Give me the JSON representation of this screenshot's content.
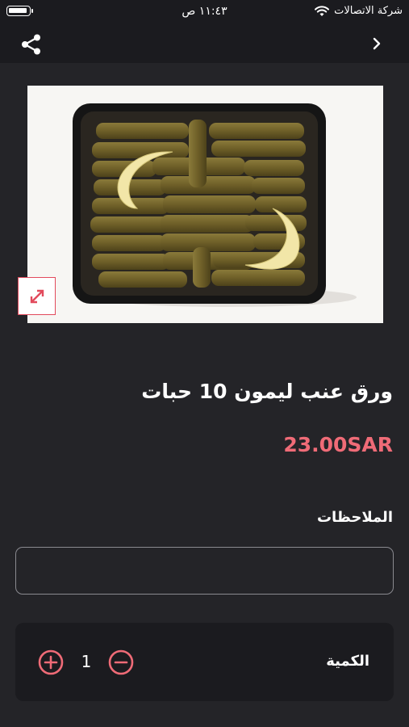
{
  "status_bar": {
    "carrier": "شركة الاتصالات",
    "time": "١١:٤٣ ص"
  },
  "nav": {
    "back_icon": "chevron-right-icon",
    "share_icon": "share-icon"
  },
  "product": {
    "image_alt": "",
    "expand_icon": "expand-icon",
    "title": "ورق عنب ليمون 10 حبات",
    "price": "23.00SAR"
  },
  "notes": {
    "label": "الملاحظات",
    "value": "",
    "placeholder": ""
  },
  "quantity": {
    "label": "الكمية",
    "value": "1",
    "plus_icon": "plus-circle-icon",
    "minus_icon": "minus-circle-icon"
  },
  "colors": {
    "background": "#242428",
    "bar": "#1b1b1f",
    "accent": "#ef6b77",
    "accent_border": "#e24a5c"
  }
}
